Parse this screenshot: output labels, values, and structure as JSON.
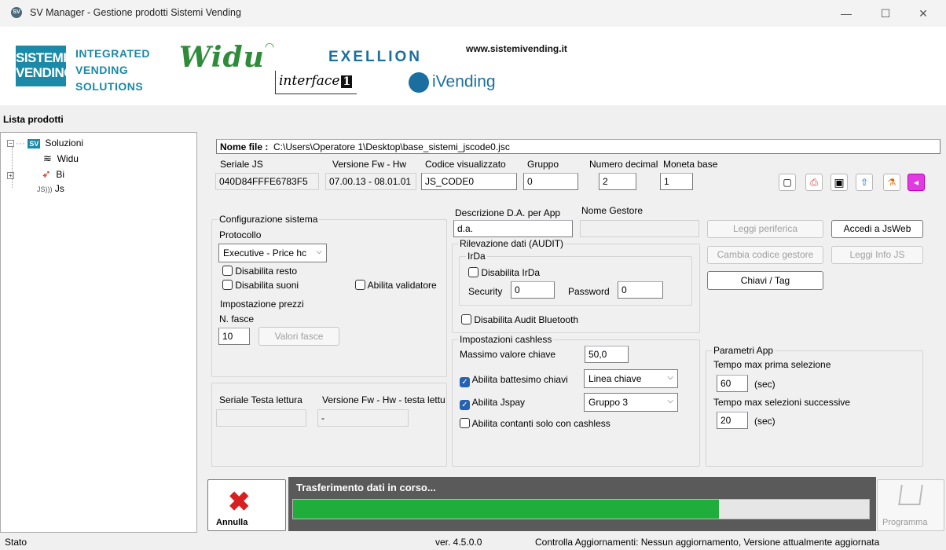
{
  "window": {
    "title": "SV Manager - Gestione prodotti Sistemi Vending",
    "icon_label": "SV",
    "controls": {
      "minimize": "—",
      "maximize": "☐",
      "close": "✕"
    }
  },
  "header": {
    "sv_logo": "SISTEMI VENDING",
    "integrated": "INTEGRATED",
    "vending": "VENDING",
    "solutions": "SOLUTIONS",
    "widu": "Widu",
    "exellion": "EXELLION",
    "interface": "interface",
    "interface_num": "1",
    "ivending": "iVending",
    "url": "www.sistemivending.it"
  },
  "sidebar": {
    "title": "Lista prodotti",
    "tree": [
      {
        "label": "Soluzioni",
        "badge": "SV",
        "expander": "−"
      },
      {
        "label": "Widu"
      },
      {
        "label": "Bi",
        "expander": "+"
      },
      {
        "label": "Js"
      }
    ]
  },
  "file": {
    "label": "Nome file :",
    "path": "C:\\Users\\Operatore 1\\Desktop\\base_sistemi_jscode0.jsc"
  },
  "info": {
    "serial_label": "Seriale JS",
    "serial": "040D84FFFE6783F5",
    "fw_label": "Versione Fw - Hw",
    "fw": "07.00.13 - 08.01.01",
    "code_label": "Codice visualizzato",
    "code": "JS_CODE0",
    "group_label": "Gruppo",
    "group": "0",
    "decimals_label": "Numero decimal",
    "decimals": "2",
    "coin_label": "Moneta base",
    "coin": "1"
  },
  "config": {
    "title": "Configurazione sistema",
    "protocol_label": "Protocollo",
    "protocol": "Executive - Price hc",
    "disable_change": "Disabilita resto",
    "disable_sounds": "Disabilita suoni",
    "enable_validator": "Abilita validatore",
    "prices_title": "Impostazione prezzi",
    "bands_label": "N. fasce",
    "bands": "10",
    "bands_button": "Valori fasce"
  },
  "reader": {
    "serial_label": "Seriale Testa lettura",
    "fw_label": "Versione Fw - Hw - testa lettu",
    "fw": "-"
  },
  "audit": {
    "desc_label": "Descrizione D.A. per App",
    "desc": "d.a.",
    "manager_label": "Nome Gestore",
    "manager": "",
    "title": "Rilevazione dati (AUDIT)",
    "irda_title": "IrDa",
    "disable_irda": "Disabilita IrDa",
    "security_label": "Security",
    "security": "0",
    "password_label": "Password",
    "password": "0",
    "disable_bt": "Disabilita Audit Bluetooth"
  },
  "cashless": {
    "title": "Impostazioni cashless",
    "max_key_label": "Massimo valore chiave",
    "max_key": "50,0",
    "baptism_label": "Abilita battesimo chiavi",
    "baptism_value": "Linea chiave",
    "jspay_label": "Abilita Jspay",
    "jspay_value": "Gruppo 3",
    "cash_only_label": "Abilita contanti solo con cashless"
  },
  "actions": {
    "read_peripheral": "Leggi periferica",
    "jsweb": "Accedi a JsWeb",
    "change_code": "Cambia codice gestore",
    "read_info": "Leggi Info JS",
    "keys_tags": "Chiavi / Tag"
  },
  "app_params": {
    "title": "Parametri App",
    "first_label": "Tempo max prima selezione",
    "first": "60",
    "first_unit": "(sec)",
    "next_label": "Tempo max selezioni successive",
    "next": "20",
    "next_unit": "(sec)"
  },
  "transfer": {
    "cancel": "Annulla",
    "message": "Trasferimento dati in corso...",
    "progress": 0.74,
    "program": "Programma",
    "progress_color": "#1fae3b"
  },
  "status": {
    "label": "Stato",
    "version": "ver. 4.5.0.0",
    "updates": "Controlla Aggiornamenti: Nessun aggiornamento, Versione attualmente aggiornata"
  }
}
